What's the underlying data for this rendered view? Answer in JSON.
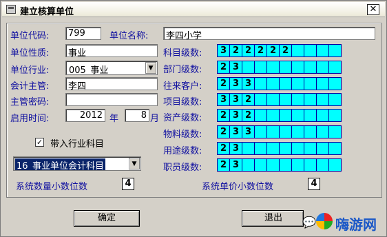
{
  "window": {
    "title": "建立核算单位",
    "close_label": "✕"
  },
  "left": {
    "code_label": "单位代码:",
    "code_value": "799",
    "name_label": "单位名称:",
    "name_value": "李四小学",
    "nature_label": "单位性质:",
    "nature_value": "事业",
    "industry_label": "单位行业:",
    "industry_value": "005_事业",
    "accountant_label": "会计主管:",
    "accountant_value": "李四",
    "password_label": "主管密码:",
    "password_value": "",
    "start_label": "启用时间:",
    "start_year": "2012",
    "year_unit": "年",
    "start_month": "8",
    "month_unit": "月",
    "import_checkbox_label": "带入行业科目",
    "import_checked": true,
    "subject_combo_value": "16_事业单位会计科目",
    "qty_decimal_label": "系统数量小数位数",
    "qty_decimal_value": "4"
  },
  "right": {
    "levels": [
      {
        "label": "科目级数:",
        "values": [
          "3",
          "2",
          "2",
          "2",
          "2",
          "2",
          "",
          "",
          "",
          ""
        ]
      },
      {
        "label": "部门级数:",
        "values": [
          "2",
          "3",
          "",
          "",
          "",
          "",
          "",
          "",
          "",
          ""
        ]
      },
      {
        "label": "往来客户:",
        "values": [
          "2",
          "3",
          "3",
          "",
          "",
          "",
          "",
          "",
          "",
          ""
        ]
      },
      {
        "label": "项目级数:",
        "values": [
          "3",
          "3",
          "2",
          "",
          "",
          "",
          "",
          "",
          "",
          ""
        ]
      },
      {
        "label": "资产级数:",
        "values": [
          "2",
          "3",
          "2",
          "",
          "",
          "",
          "",
          "",
          "",
          ""
        ]
      },
      {
        "label": "物料级数:",
        "values": [
          "2",
          "3",
          "3",
          "",
          "",
          "",
          "",
          "",
          "",
          ""
        ]
      },
      {
        "label": "用途级数:",
        "values": [
          "2",
          "3",
          "",
          "",
          "",
          "",
          "",
          "",
          "",
          ""
        ]
      },
      {
        "label": "职员级数:",
        "values": [
          "2",
          "3",
          "",
          "",
          "",
          "",
          "",
          "",
          "",
          ""
        ]
      }
    ],
    "price_decimal_label": "系统单价小数位数",
    "price_decimal_value": "4"
  },
  "buttons": {
    "ok_label": "确定",
    "exit_label": "退出"
  },
  "watermark": {
    "text": "嗨游网",
    "chat_icon": "chat-bubble-icon"
  },
  "colors": {
    "cell_fill": "#00ffff",
    "label_blue": "#1010a0",
    "dialog_bg": "#d4d0c8"
  }
}
